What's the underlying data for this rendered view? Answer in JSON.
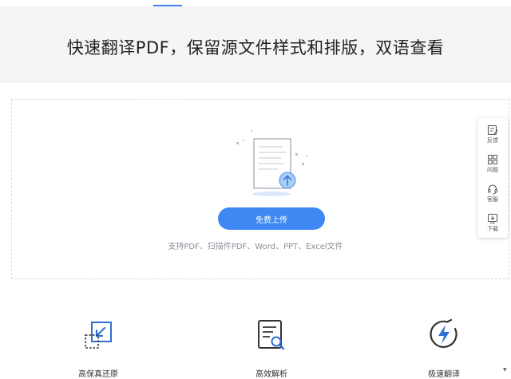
{
  "hero": {
    "title": "快速翻译PDF，保留源文件样式和排版，双语查看"
  },
  "upload": {
    "button_label": "免费上传",
    "hint": "支持PDF、扫描件PDF、Word、PPT、Excel文件"
  },
  "sidebar": {
    "items": [
      {
        "label": "反馈",
        "icon": "feedback-icon"
      },
      {
        "label": "问题",
        "icon": "grid-icon"
      },
      {
        "label": "客服",
        "icon": "headset-icon"
      },
      {
        "label": "下载",
        "icon": "download-icon"
      }
    ]
  },
  "features": [
    {
      "label": "高保真还原",
      "icon": "restore-icon"
    },
    {
      "label": "高效解析",
      "icon": "document-search-icon"
    },
    {
      "label": "极速翻译",
      "icon": "lightning-icon"
    }
  ],
  "colors": {
    "accent": "#3d88f2",
    "hero_bg": "#f4f5f7",
    "icon_blue": "#2f6fd6"
  }
}
